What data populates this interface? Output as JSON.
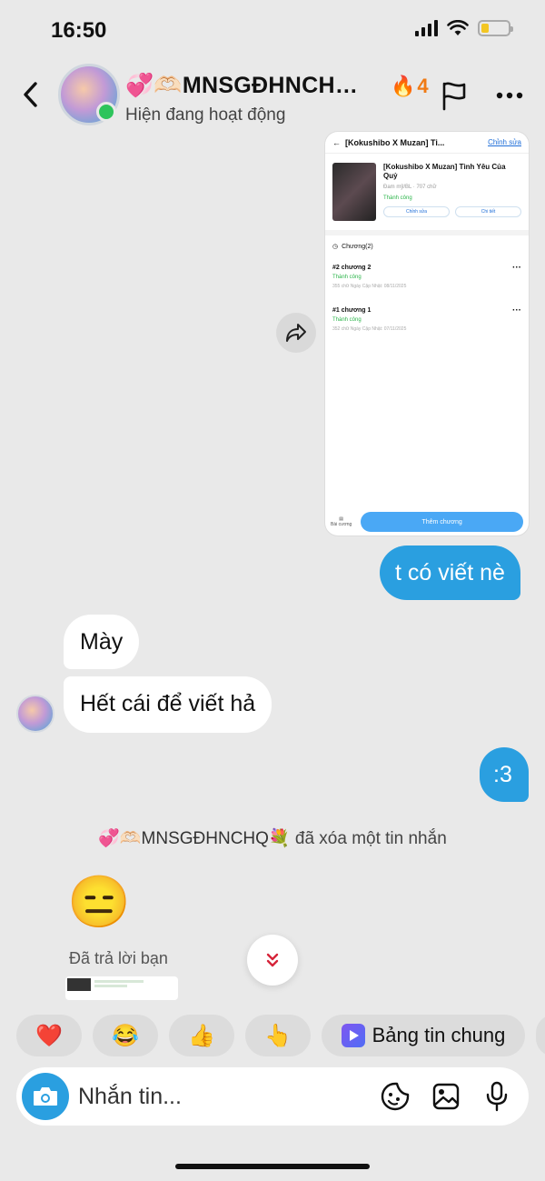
{
  "status_bar": {
    "time": "16:50"
  },
  "header": {
    "name": "💞🫶🏻MNSGĐHNCH…",
    "status": "Hiện đang hoạt động",
    "streak_count": "4",
    "streak_icon": "🔥"
  },
  "shared_card": {
    "top_title": "[Kokushibo X Muzan] Ti...",
    "top_edit": "Chỉnh sửa",
    "story_title": "[Kokushibo X Muzan] Tình Yêu Của Quỷ",
    "story_meta": "Đam mỹ/BL · 707 chữ",
    "story_status": "Thành công",
    "btn_edit": "Chỉnh sửa",
    "btn_detail": "Chi tiết",
    "chapters_header": "Chương(2)",
    "chapters": [
      {
        "title": "#2 chương 2",
        "status": "Thành công",
        "meta": "355 chữ Ngày Cập Nhật: 08/11/2025"
      },
      {
        "title": "#1 chương 1",
        "status": "Thành công",
        "meta": "352 chữ Ngày Cập Nhật: 07/11/2025"
      }
    ],
    "bottom_mini": "Bài cương",
    "add_button": "Thêm chương"
  },
  "messages": {
    "out_1": "t có viết nè",
    "in_1": "Mày",
    "in_2": "Hết cái để viết hả",
    "out_2": ":3",
    "system_name": "💞🫶🏻MNSGĐHNCHQ💐",
    "system_action": " đã xóa một tin nhắn",
    "emoji": "😑",
    "reply_label": "Đã trả lời bạn"
  },
  "quick_replies": {
    "heart": "❤️",
    "laugh": "😂",
    "thumb": "👍",
    "point": "👆",
    "board_label": "Bảng tin chung"
  },
  "composer": {
    "placeholder": "Nhắn tin..."
  },
  "colors": {
    "outgoing_bubble": "#2a9fe0",
    "online": "#2ec45c",
    "streak": "#f07a14"
  }
}
